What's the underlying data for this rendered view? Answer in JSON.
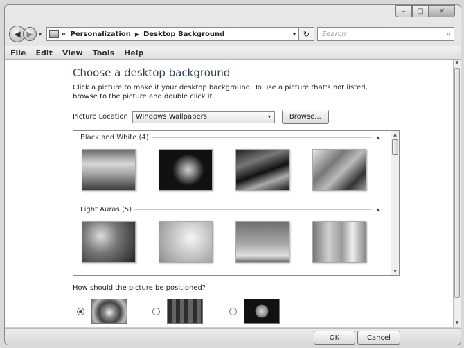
{
  "window": {
    "min_label": "–",
    "max_label": "□",
    "close_label": "✕"
  },
  "nav": {
    "back_icon": "◀",
    "forward_icon": "▶",
    "history_icon": "▾",
    "address_prefix": "«",
    "breadcrumb": [
      "Personalization",
      "Desktop Background"
    ],
    "breadcrumb_sep": "▶",
    "address_drop": "▾",
    "refresh_icon": "↻",
    "search_placeholder": "Search",
    "search_icon": "⌕"
  },
  "menu": [
    "File",
    "Edit",
    "View",
    "Tools",
    "Help"
  ],
  "page": {
    "title": "Choose a desktop background",
    "description": "Click a picture to make it your desktop background. To use a picture that's not listed, browse to the picture and double click it.",
    "location_label": "Picture Location",
    "location_value": "Windows Wallpapers",
    "location_drop": "▾",
    "browse_label": "Browse..."
  },
  "gallery": {
    "groups": [
      {
        "label": "Black and White (4)",
        "collapse": "▴"
      },
      {
        "label": "Light Auras (5)",
        "collapse": "▴"
      }
    ]
  },
  "position": {
    "question": "How should the picture be positioned?",
    "selected": 0
  },
  "footer": {
    "ok_label": "OK",
    "cancel_label": "Cancel"
  }
}
